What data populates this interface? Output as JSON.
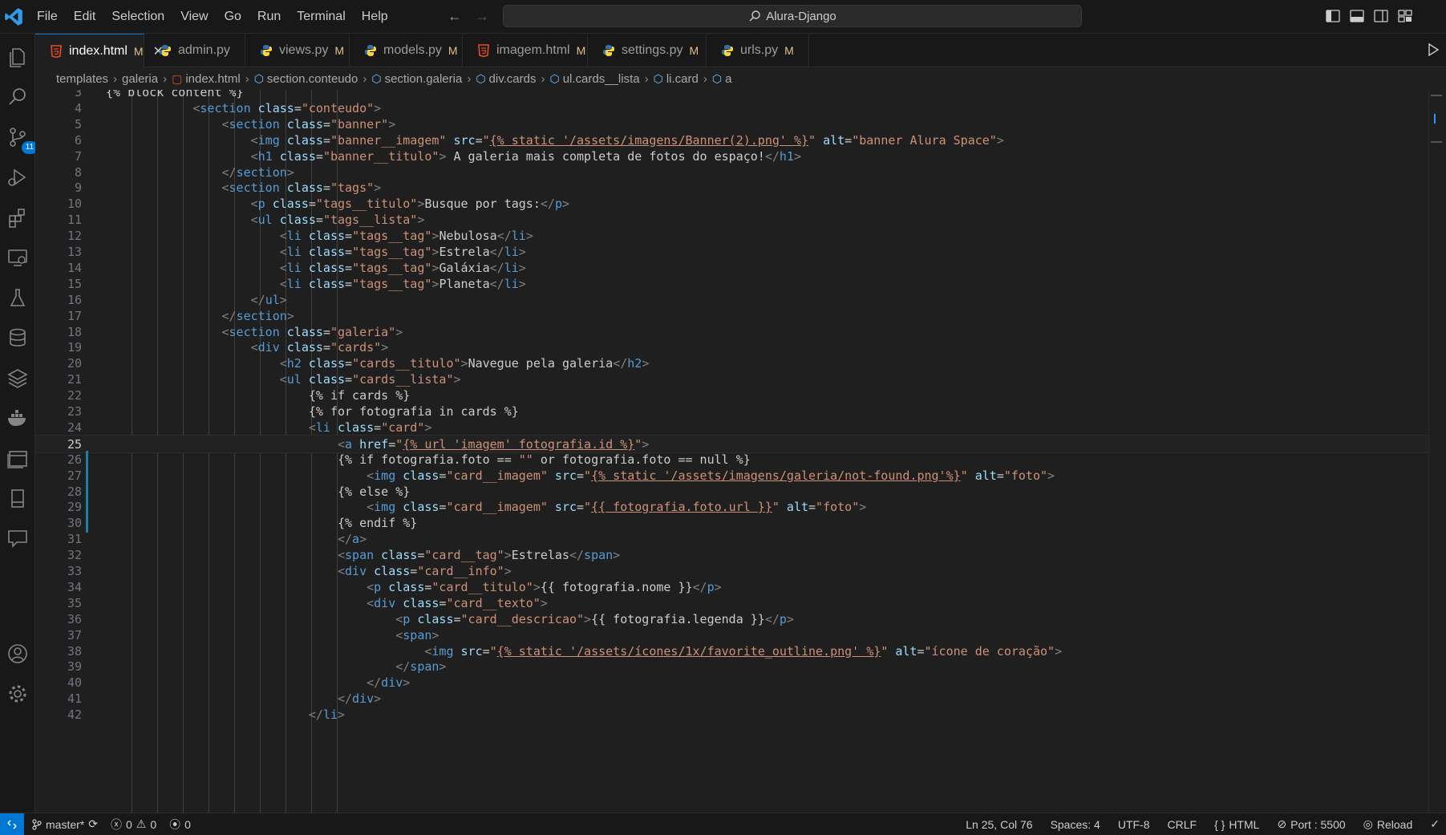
{
  "titlebar": {
    "menu": [
      "File",
      "Edit",
      "Selection",
      "View",
      "Go",
      "Run",
      "Terminal",
      "Help"
    ],
    "search_text": "Alura-Django"
  },
  "activity": {
    "scm_badge": "11"
  },
  "tabs": [
    {
      "label": "index.html",
      "status": "M",
      "type": "html",
      "active": true
    },
    {
      "label": "admin.py",
      "status": "",
      "type": "py",
      "active": false
    },
    {
      "label": "views.py",
      "status": "M",
      "type": "py",
      "active": false
    },
    {
      "label": "models.py",
      "status": "M",
      "type": "py",
      "active": false
    },
    {
      "label": "imagem.html",
      "status": "M",
      "type": "html",
      "active": false
    },
    {
      "label": "settings.py",
      "status": "M",
      "type": "py",
      "active": false
    },
    {
      "label": "urls.py",
      "status": "M",
      "type": "py",
      "active": false
    }
  ],
  "breadcrumbs": [
    "templates",
    "galeria",
    "index.html",
    "section.conteudo",
    "section.galeria",
    "div.cards",
    "ul.cards__lista",
    "li.card",
    "a"
  ],
  "editor": {
    "current_line": 25,
    "lines": [
      {
        "n": 3,
        "text": "{% block content %}"
      },
      {
        "n": 4,
        "text": "            <section class=\"conteudo\">"
      },
      {
        "n": 5,
        "text": "                <section class=\"banner\">"
      },
      {
        "n": 6,
        "text": "                    <img class=\"banner__imagem\" src=\"{% static '/assets/imagens/Banner(2).png' %}\" alt=\"banner Alura Space\">"
      },
      {
        "n": 7,
        "text": "                    <h1 class=\"banner__titulo\"> A galeria mais completa de fotos do espaço!</h1>"
      },
      {
        "n": 8,
        "text": "                </section>"
      },
      {
        "n": 9,
        "text": "                <section class=\"tags\">"
      },
      {
        "n": 10,
        "text": "                    <p class=\"tags__titulo\">Busque por tags:</p>"
      },
      {
        "n": 11,
        "text": "                    <ul class=\"tags__lista\">"
      },
      {
        "n": 12,
        "text": "                        <li class=\"tags__tag\">Nebulosa</li>"
      },
      {
        "n": 13,
        "text": "                        <li class=\"tags__tag\">Estrela</li>"
      },
      {
        "n": 14,
        "text": "                        <li class=\"tags__tag\">Galáxia</li>"
      },
      {
        "n": 15,
        "text": "                        <li class=\"tags__tag\">Planeta</li>"
      },
      {
        "n": 16,
        "text": "                    </ul>"
      },
      {
        "n": 17,
        "text": "                </section>"
      },
      {
        "n": 18,
        "text": "                <section class=\"galeria\">"
      },
      {
        "n": 19,
        "text": "                    <div class=\"cards\">"
      },
      {
        "n": 20,
        "text": "                        <h2 class=\"cards__titulo\">Navegue pela galeria</h2>"
      },
      {
        "n": 21,
        "text": "                        <ul class=\"cards__lista\">"
      },
      {
        "n": 22,
        "text": "                            {% if cards %}"
      },
      {
        "n": 23,
        "text": "                            {% for fotografia in cards %}"
      },
      {
        "n": 24,
        "text": "                            <li class=\"card\">"
      },
      {
        "n": 25,
        "text": "                                <a href=\"{% url 'imagem' fotografia.id %}\">"
      },
      {
        "n": 26,
        "text": "                                {% if fotografia.foto == \"\" or fotografia.foto == null %}"
      },
      {
        "n": 27,
        "text": "                                    <img class=\"card__imagem\" src=\"{% static '/assets/imagens/galeria/not-found.png'%}\" alt=\"foto\">"
      },
      {
        "n": 28,
        "text": "                                {% else %}"
      },
      {
        "n": 29,
        "text": "                                    <img class=\"card__imagem\" src=\"{{ fotografia.foto.url }}\" alt=\"foto\">"
      },
      {
        "n": 30,
        "text": "                                {% endif %}"
      },
      {
        "n": 31,
        "text": "                                </a>"
      },
      {
        "n": 32,
        "text": "                                <span class=\"card__tag\">Estrelas</span>"
      },
      {
        "n": 33,
        "text": "                                <div class=\"card__info\">"
      },
      {
        "n": 34,
        "text": "                                    <p class=\"card__titulo\">{{ fotografia.nome }}</p>"
      },
      {
        "n": 35,
        "text": "                                    <div class=\"card__texto\">"
      },
      {
        "n": 36,
        "text": "                                        <p class=\"card__descricao\">{{ fotografia.legenda }}</p>"
      },
      {
        "n": 37,
        "text": "                                        <span>"
      },
      {
        "n": 38,
        "text": "                                            <img src=\"{% static '/assets/ícones/1x/favorite_outline.png' %}\" alt=\"ícone de coração\">"
      },
      {
        "n": 39,
        "text": "                                        </span>"
      },
      {
        "n": 40,
        "text": "                                    </div>"
      },
      {
        "n": 41,
        "text": "                                </div>"
      },
      {
        "n": 42,
        "text": "                            </li>"
      }
    ]
  },
  "statusbar": {
    "branch": "master*",
    "errors": "0",
    "warnings": "0",
    "ports": "0",
    "cursor": "Ln 25, Col 76",
    "spaces": "Spaces: 4",
    "encoding": "UTF-8",
    "eol": "CRLF",
    "language": "HTML",
    "port": "Port : 5500",
    "reload": "Reload"
  },
  "colors": {
    "accent": "#0078d4",
    "tag": "#569cd6",
    "attr": "#9cdcfe",
    "string": "#ce9178",
    "modified": "#e2c08d"
  }
}
